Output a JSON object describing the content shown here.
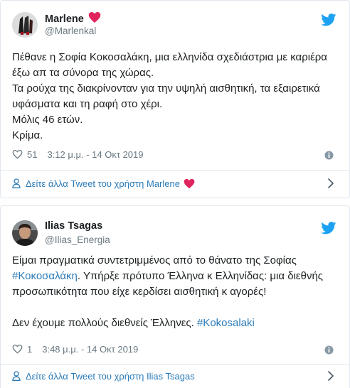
{
  "tweets": [
    {
      "name": "Marlene",
      "handle": "@Marlenkal",
      "lines": [
        "Πέθανε η Σοφία Κοκοσαλάκη, μια ελληνίδα σχεδιάστρια με καριέρα",
        "έξω απ τα σύνορα της χώρας.",
        "Τα ρούχα της διακρίνονταν για την υψηλή αισθητική, τα εξαιρετικά",
        "υφάσματα και τη ραφή στο χέρι.",
        "Μόλις 46 ετών.",
        "Κρίμα."
      ],
      "likes": "51",
      "timestamp": "3:12 μ.μ. - 14 Οκτ 2019",
      "more_link": "Δείτε άλλα Tweet του χρήστη Marlene"
    },
    {
      "name": "Ilias Tsagas",
      "handle": "@Ilias_Energia",
      "line1": "Είμαι πραγματικά συντετριμμένος από το θάνατο της Σοφίας",
      "line2_hashtag": "#Κοκοσαλάκη",
      "line2_rest": ". Υπήρξε πρότυπο Έλληνα κ Ελληνίδας: μια διεθνής",
      "line3": "προσωπικότητα που είχε κερδίσει αισθητική κ αγορές!",
      "line5_text": "Δεν έχουμε πολλούς διεθνείς Έλληνες. ",
      "line5_hashtag": "#Kokosalaki",
      "likes": "1",
      "timestamp": "3:48 μ.μ. - 14 Οκτ 2019",
      "more_link": "Δείτε άλλα Tweet του χρήστη Ilias Tsagas"
    }
  ],
  "colors": {
    "twitter_blue": "#1da1f2",
    "link": "#2b7bb9",
    "meta_gray": "#697882",
    "heart_red": "#e0245e"
  },
  "icons": [
    "avatar",
    "red-heart-icon",
    "twitter-bird-icon",
    "like-heart-icon",
    "info-icon",
    "user-icon",
    "chevron-right-icon"
  ]
}
